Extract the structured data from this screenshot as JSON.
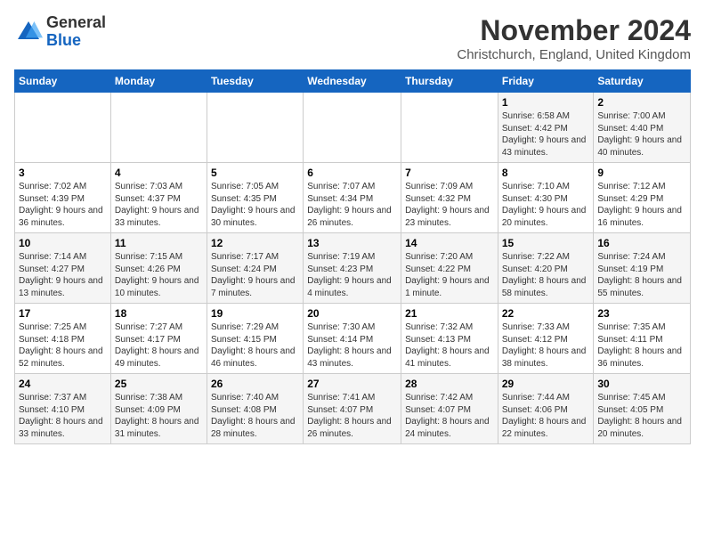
{
  "header": {
    "logo_general": "General",
    "logo_blue": "Blue",
    "month_title": "November 2024",
    "location": "Christchurch, England, United Kingdom"
  },
  "weekdays": [
    "Sunday",
    "Monday",
    "Tuesday",
    "Wednesday",
    "Thursday",
    "Friday",
    "Saturday"
  ],
  "weeks": [
    [
      {
        "day": "",
        "info": ""
      },
      {
        "day": "",
        "info": ""
      },
      {
        "day": "",
        "info": ""
      },
      {
        "day": "",
        "info": ""
      },
      {
        "day": "",
        "info": ""
      },
      {
        "day": "1",
        "info": "Sunrise: 6:58 AM\nSunset: 4:42 PM\nDaylight: 9 hours and 43 minutes."
      },
      {
        "day": "2",
        "info": "Sunrise: 7:00 AM\nSunset: 4:40 PM\nDaylight: 9 hours and 40 minutes."
      }
    ],
    [
      {
        "day": "3",
        "info": "Sunrise: 7:02 AM\nSunset: 4:39 PM\nDaylight: 9 hours and 36 minutes."
      },
      {
        "day": "4",
        "info": "Sunrise: 7:03 AM\nSunset: 4:37 PM\nDaylight: 9 hours and 33 minutes."
      },
      {
        "day": "5",
        "info": "Sunrise: 7:05 AM\nSunset: 4:35 PM\nDaylight: 9 hours and 30 minutes."
      },
      {
        "day": "6",
        "info": "Sunrise: 7:07 AM\nSunset: 4:34 PM\nDaylight: 9 hours and 26 minutes."
      },
      {
        "day": "7",
        "info": "Sunrise: 7:09 AM\nSunset: 4:32 PM\nDaylight: 9 hours and 23 minutes."
      },
      {
        "day": "8",
        "info": "Sunrise: 7:10 AM\nSunset: 4:30 PM\nDaylight: 9 hours and 20 minutes."
      },
      {
        "day": "9",
        "info": "Sunrise: 7:12 AM\nSunset: 4:29 PM\nDaylight: 9 hours and 16 minutes."
      }
    ],
    [
      {
        "day": "10",
        "info": "Sunrise: 7:14 AM\nSunset: 4:27 PM\nDaylight: 9 hours and 13 minutes."
      },
      {
        "day": "11",
        "info": "Sunrise: 7:15 AM\nSunset: 4:26 PM\nDaylight: 9 hours and 10 minutes."
      },
      {
        "day": "12",
        "info": "Sunrise: 7:17 AM\nSunset: 4:24 PM\nDaylight: 9 hours and 7 minutes."
      },
      {
        "day": "13",
        "info": "Sunrise: 7:19 AM\nSunset: 4:23 PM\nDaylight: 9 hours and 4 minutes."
      },
      {
        "day": "14",
        "info": "Sunrise: 7:20 AM\nSunset: 4:22 PM\nDaylight: 9 hours and 1 minute."
      },
      {
        "day": "15",
        "info": "Sunrise: 7:22 AM\nSunset: 4:20 PM\nDaylight: 8 hours and 58 minutes."
      },
      {
        "day": "16",
        "info": "Sunrise: 7:24 AM\nSunset: 4:19 PM\nDaylight: 8 hours and 55 minutes."
      }
    ],
    [
      {
        "day": "17",
        "info": "Sunrise: 7:25 AM\nSunset: 4:18 PM\nDaylight: 8 hours and 52 minutes."
      },
      {
        "day": "18",
        "info": "Sunrise: 7:27 AM\nSunset: 4:17 PM\nDaylight: 8 hours and 49 minutes."
      },
      {
        "day": "19",
        "info": "Sunrise: 7:29 AM\nSunset: 4:15 PM\nDaylight: 8 hours and 46 minutes."
      },
      {
        "day": "20",
        "info": "Sunrise: 7:30 AM\nSunset: 4:14 PM\nDaylight: 8 hours and 43 minutes."
      },
      {
        "day": "21",
        "info": "Sunrise: 7:32 AM\nSunset: 4:13 PM\nDaylight: 8 hours and 41 minutes."
      },
      {
        "day": "22",
        "info": "Sunrise: 7:33 AM\nSunset: 4:12 PM\nDaylight: 8 hours and 38 minutes."
      },
      {
        "day": "23",
        "info": "Sunrise: 7:35 AM\nSunset: 4:11 PM\nDaylight: 8 hours and 36 minutes."
      }
    ],
    [
      {
        "day": "24",
        "info": "Sunrise: 7:37 AM\nSunset: 4:10 PM\nDaylight: 8 hours and 33 minutes."
      },
      {
        "day": "25",
        "info": "Sunrise: 7:38 AM\nSunset: 4:09 PM\nDaylight: 8 hours and 31 minutes."
      },
      {
        "day": "26",
        "info": "Sunrise: 7:40 AM\nSunset: 4:08 PM\nDaylight: 8 hours and 28 minutes."
      },
      {
        "day": "27",
        "info": "Sunrise: 7:41 AM\nSunset: 4:07 PM\nDaylight: 8 hours and 26 minutes."
      },
      {
        "day": "28",
        "info": "Sunrise: 7:42 AM\nSunset: 4:07 PM\nDaylight: 8 hours and 24 minutes."
      },
      {
        "day": "29",
        "info": "Sunrise: 7:44 AM\nSunset: 4:06 PM\nDaylight: 8 hours and 22 minutes."
      },
      {
        "day": "30",
        "info": "Sunrise: 7:45 AM\nSunset: 4:05 PM\nDaylight: 8 hours and 20 minutes."
      }
    ]
  ]
}
